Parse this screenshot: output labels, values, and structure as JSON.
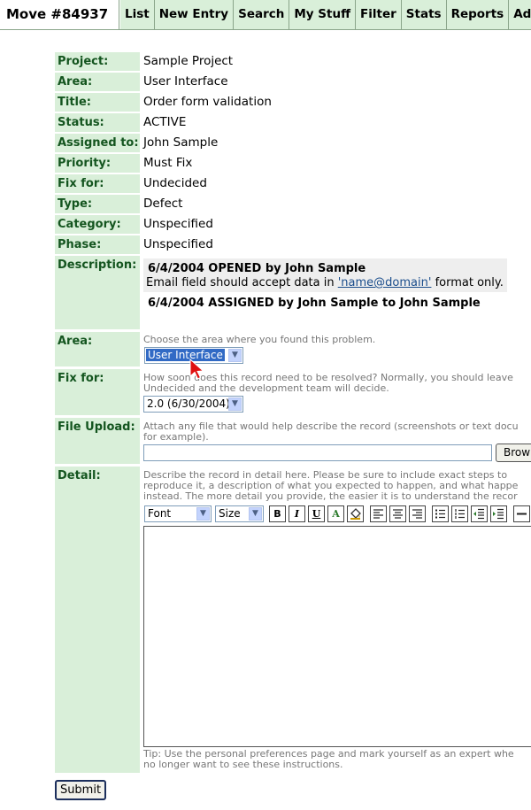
{
  "nav": {
    "title": "Move #84937",
    "tabs": [
      "List",
      "New Entry",
      "Search",
      "My Stuff",
      "Filter",
      "Stats",
      "Reports",
      "Admin"
    ]
  },
  "fields": {
    "project": {
      "label": "Project:",
      "value": "Sample Project"
    },
    "area": {
      "label": "Area:",
      "value": "User Interface"
    },
    "title": {
      "label": "Title:",
      "value": "Order form validation"
    },
    "status": {
      "label": "Status:",
      "value": "ACTIVE"
    },
    "assigned_to": {
      "label": "Assigned to:",
      "value": "John Sample"
    },
    "priority": {
      "label": "Priority:",
      "value": "Must Fix"
    },
    "fix_for": {
      "label": "Fix for:",
      "value": "Undecided"
    },
    "type": {
      "label": "Type:",
      "value": "Defect"
    },
    "category": {
      "label": "Category:",
      "value": "Unspecified"
    },
    "phase": {
      "label": "Phase:",
      "value": "Unspecified"
    }
  },
  "description": {
    "label": "Description:",
    "entry1_header": "6/4/2004 OPENED by John Sample",
    "entry1_text_before": "Email field should accept data in ",
    "entry1_link": "'name@domain'",
    "entry1_text_after": " format only.",
    "entry2_header": "6/4/2004 ASSIGNED by John Sample to John Sample"
  },
  "edit": {
    "area": {
      "label": "Area:",
      "hint": "Choose the area where you found this problem.",
      "selected": "User Interface"
    },
    "fix_for": {
      "label": "Fix for:",
      "hint1": "How soon does this record need to be resolved? Normally, you should leave",
      "hint2": "Undecided and the development team will decide.",
      "selected": "2.0 (6/30/2004)"
    },
    "file_upload": {
      "label": "File Upload:",
      "hint1": "Attach any file that would help describe the record (screenshots or text docu",
      "hint2": "for example).",
      "browse_label": "Brow"
    },
    "detail": {
      "label": "Detail:",
      "hint1": "Describe the record in detail here. Please be sure to include exact steps to",
      "hint2": "reproduce it, a description of what you expected to happen, and what happe",
      "hint3": "instead. The more detail you provide, the easier it is to understand the recor",
      "font_select": "Font",
      "size_select": "Size",
      "tip1": "Tip: Use the personal preferences page and mark yourself as an expert whe",
      "tip2": "no longer want to see these instructions."
    }
  },
  "toolbar": {
    "bold": "B",
    "italic": "I",
    "underline": "U",
    "color": "A"
  },
  "submit_label": "Submit"
}
